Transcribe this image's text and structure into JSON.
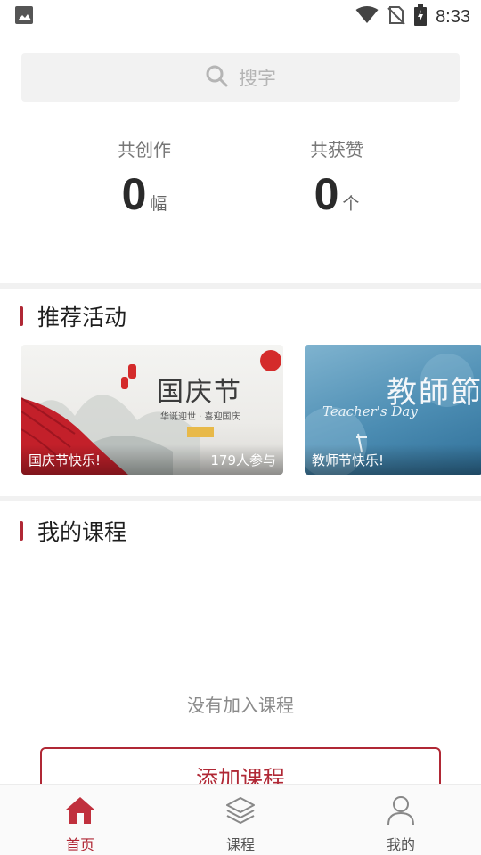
{
  "status_bar": {
    "time": "8:33",
    "icons": [
      "image-icon",
      "wifi-icon",
      "no-sim-icon",
      "battery-charging-icon"
    ]
  },
  "search": {
    "placeholder": "搜字",
    "icon": "search-icon"
  },
  "stats": {
    "created": {
      "label": "共创作",
      "value": "0",
      "unit": "幅"
    },
    "likes": {
      "label": "共获赞",
      "value": "0",
      "unit": "个"
    }
  },
  "activities": {
    "title": "推荐活动",
    "items": [
      {
        "poster_title": "国庆节",
        "poster_subtitle": "华诞迎世 · 喜迎国庆",
        "caption": "国庆节快乐!",
        "count": "179人参与"
      },
      {
        "poster_title": "教師節",
        "poster_script": "Teacher's Day",
        "caption": "教师节快乐!"
      }
    ]
  },
  "courses": {
    "title": "我的课程",
    "empty_text": "没有加入课程",
    "add_button": "添加课程"
  },
  "bottom_nav": {
    "items": [
      {
        "label": "首页",
        "icon": "home-icon",
        "active": true
      },
      {
        "label": "课程",
        "icon": "layers-icon",
        "active": false
      },
      {
        "label": "我的",
        "icon": "user-icon",
        "active": false
      }
    ]
  },
  "colors": {
    "accent": "#b02835",
    "background": "#ffffff",
    "band": "#f1f1f1"
  }
}
